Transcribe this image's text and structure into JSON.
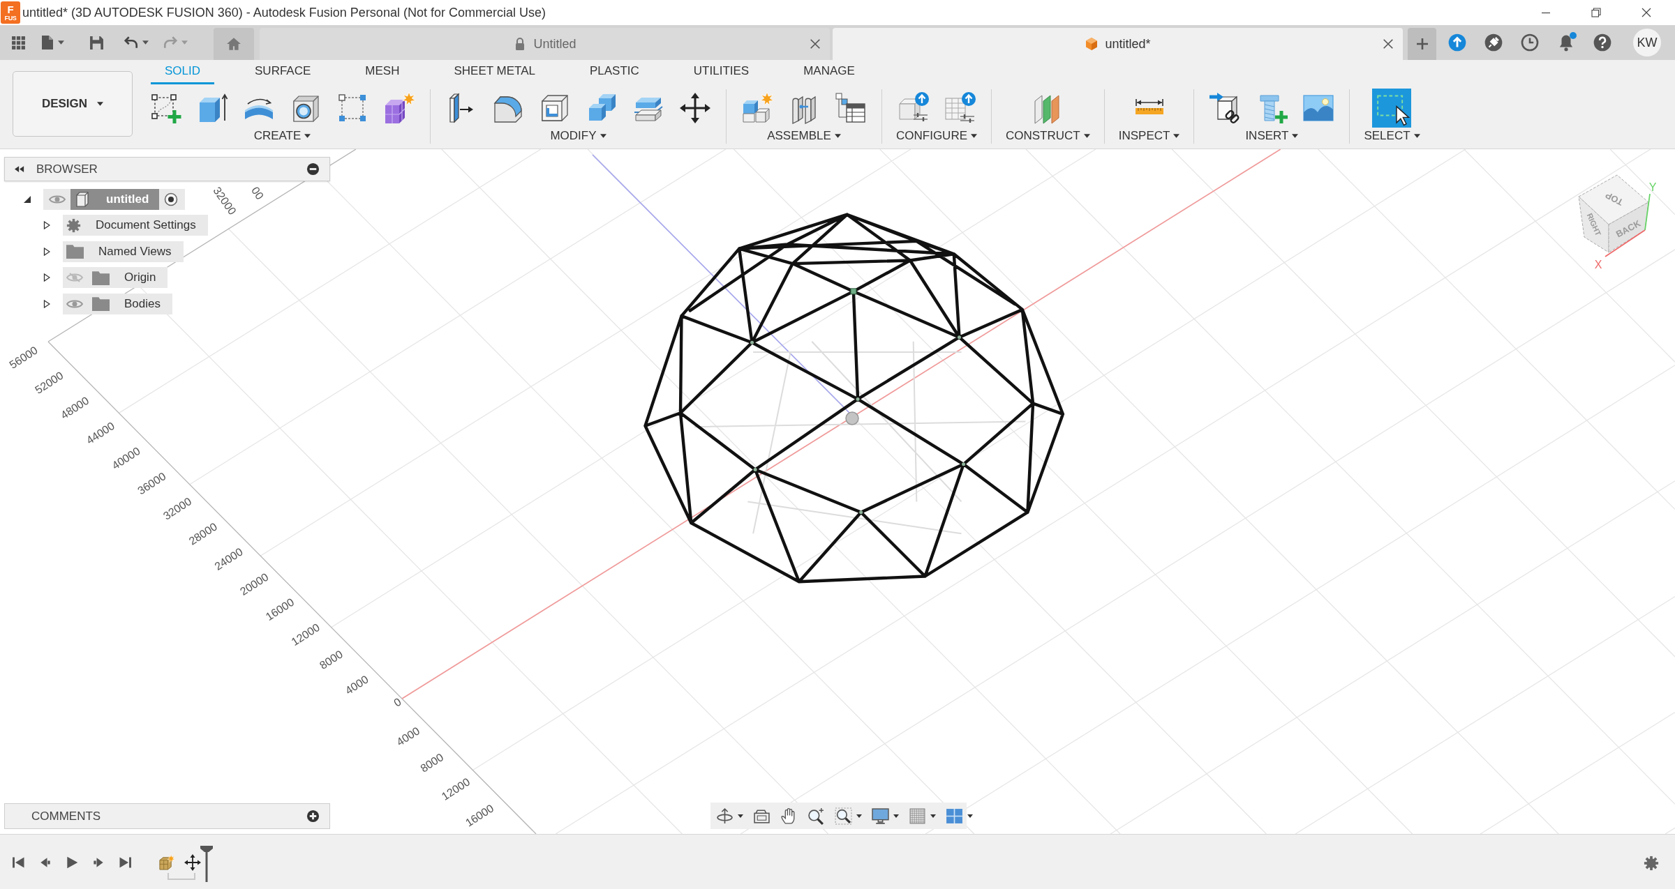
{
  "window": {
    "title": "untitled* (3D AUTODESK FUSION 360) - Autodesk Fusion Personal (Not for Commercial Use)",
    "logo": {
      "letter": "F",
      "caption": "FUS"
    }
  },
  "document_tabs": [
    {
      "label": "Untitled",
      "selected": false,
      "locked": true
    },
    {
      "label": "untitled*",
      "selected": true,
      "locked": false
    }
  ],
  "notifications": {
    "unread": true
  },
  "account": {
    "initials": "KW"
  },
  "workspace": {
    "label": "DESIGN"
  },
  "toolbar_tabs": [
    {
      "label": "SOLID",
      "selected": true
    },
    {
      "label": "SURFACE",
      "selected": false
    },
    {
      "label": "MESH",
      "selected": false
    },
    {
      "label": "SHEET METAL",
      "selected": false
    },
    {
      "label": "PLASTIC",
      "selected": false
    },
    {
      "label": "UTILITIES",
      "selected": false
    },
    {
      "label": "MANAGE",
      "selected": false
    }
  ],
  "tool_groups": [
    {
      "label": "CREATE"
    },
    {
      "label": "MODIFY"
    },
    {
      "label": "ASSEMBLE"
    },
    {
      "label": "CONFIGURE"
    },
    {
      "label": "CONSTRUCT"
    },
    {
      "label": "INSPECT"
    },
    {
      "label": "INSERT"
    },
    {
      "label": "SELECT"
    }
  ],
  "browser": {
    "title": "BROWSER",
    "items": [
      {
        "label": "untitled",
        "kind": "component",
        "expanded": true,
        "visible": true,
        "active": true,
        "children": [
          {
            "label": "Document Settings",
            "kind": "settings",
            "expanded": false
          },
          {
            "label": "Named Views",
            "kind": "folder",
            "expanded": false
          },
          {
            "label": "Origin",
            "kind": "folder",
            "expanded": false,
            "visible": false
          },
          {
            "label": "Bodies",
            "kind": "folder",
            "expanded": false,
            "visible": true
          }
        ]
      }
    ]
  },
  "viewport": {
    "edge_labels": [
      "56000",
      "52000",
      "48000",
      "44000",
      "40000",
      "36000",
      "32000",
      "28000",
      "24000",
      "20000",
      "16000",
      "12000",
      "8000",
      "4000",
      "0",
      "4000",
      "8000",
      "12000",
      "16000"
    ],
    "far_edge_labels": [
      "32000",
      "00"
    ],
    "view_cube": {
      "faces": [
        "TOP",
        "RIGHT",
        "BACK"
      ],
      "axes": [
        "X",
        "Y"
      ]
    }
  },
  "comments": {
    "title": "COMMENTS"
  }
}
